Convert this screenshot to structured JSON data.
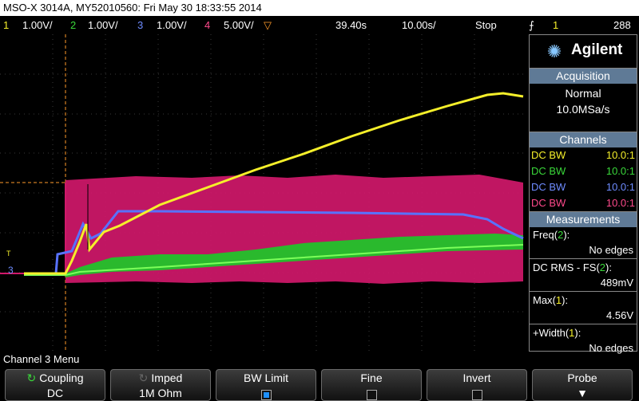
{
  "title": "MSO-X 3014A, MY52010560: Fri May 30 18:33:55 2014",
  "status": {
    "ch1": {
      "num": "1",
      "scale": "1.00V/"
    },
    "ch2": {
      "num": "2",
      "scale": "1.00V/"
    },
    "ch3": {
      "num": "3",
      "scale": "1.00V/"
    },
    "ch4": {
      "num": "4",
      "scale": "5.00V/"
    },
    "delay": "39.40s",
    "timebase": "10.00s/",
    "run_state": "Stop",
    "trigger": {
      "channel": "1",
      "level": "288"
    }
  },
  "brand": "Agilent",
  "acquisition": {
    "title": "Acquisition",
    "mode": "Normal",
    "rate": "10.0MSa/s"
  },
  "channels": {
    "title": "Channels",
    "rows": [
      {
        "label": "DC BW",
        "probe": "10.0:1",
        "color": "#f5ef2a"
      },
      {
        "label": "DC BW",
        "probe": "10.0:1",
        "color": "#3ad83a"
      },
      {
        "label": "DC BW",
        "probe": "10.0:1",
        "color": "#6e8cff"
      },
      {
        "label": "DC BW",
        "probe": "10.0:1",
        "color": "#ff4a8c"
      }
    ]
  },
  "measurements": {
    "title": "Measurements",
    "items": [
      {
        "name": "Freq",
        "src": "2",
        "src_color": "#3ad83a",
        "value": "No edges"
      },
      {
        "name": "DC RMS - FS",
        "src": "2",
        "src_color": "#3ad83a",
        "value": "489mV"
      },
      {
        "name": "Max",
        "src": "1",
        "src_color": "#f5ef2a",
        "value": "4.56V"
      },
      {
        "name": "+Width",
        "src": "1",
        "src_color": "#f5ef2a",
        "value": "No edges"
      }
    ]
  },
  "screen_markers": {
    "trigger": "T",
    "ch3": "3"
  },
  "menu_title": "Channel 3 Menu",
  "softkeys": [
    {
      "top": "Coupling",
      "bottom": "DC"
    },
    {
      "top": "Imped",
      "bottom": "1M Ohm"
    },
    {
      "top": "BW Limit",
      "checked": true
    },
    {
      "top": "Fine",
      "checked": false
    },
    {
      "top": "Invert",
      "checked": false
    },
    {
      "top": "Probe"
    }
  ],
  "colors": {
    "ch1": "#f5ef2a",
    "ch2": "#3ad83a",
    "ch3": "#6e8cff",
    "ch4": "#e0186e",
    "header": "#5f7a96"
  }
}
